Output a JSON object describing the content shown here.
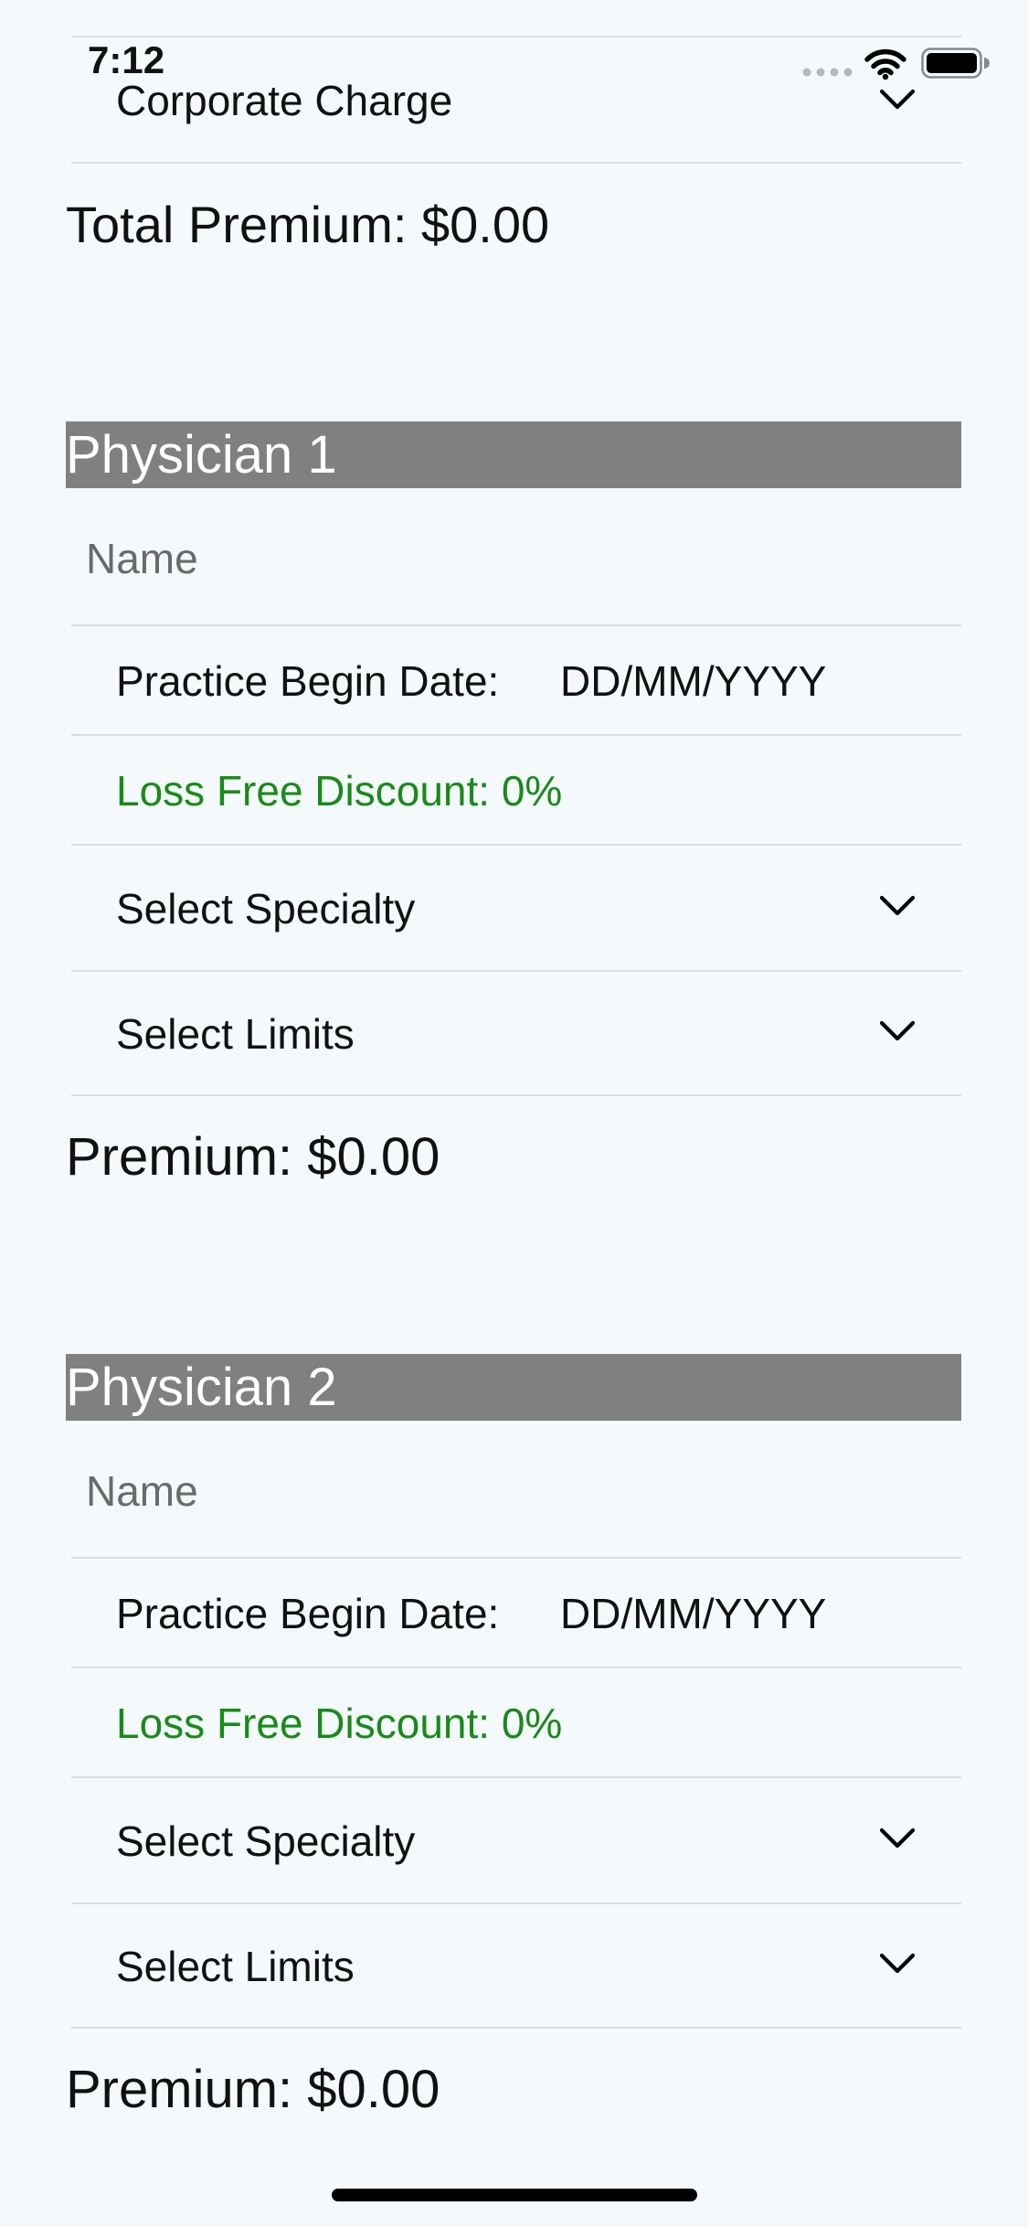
{
  "status_bar": {
    "time": "7:12",
    "icons": [
      "signal-dots-icon",
      "wifi-icon",
      "battery-icon"
    ]
  },
  "corporate_charge": {
    "label": "Corporate Charge",
    "icon": "chevron-down-icon"
  },
  "total_premium": "Total Premium: $0.00",
  "physicians": [
    {
      "title": "Physician 1",
      "name_placeholder": "Name",
      "practice_begin_label": "Practice Begin Date:",
      "practice_begin_value": "DD/MM/YYYY",
      "loss_free_discount": "Loss Free Discount: 0%",
      "specialty_label": "Select Specialty",
      "limits_label": "Select Limits",
      "premium": "Premium: $0.00"
    },
    {
      "title": "Physician 2",
      "name_placeholder": "Name",
      "practice_begin_label": "Practice Begin Date:",
      "practice_begin_value": "DD/MM/YYYY",
      "loss_free_discount": "Loss Free Discount: 0%",
      "specialty_label": "Select Specialty",
      "limits_label": "Select Limits",
      "premium": "Premium: $0.00"
    }
  ],
  "colors": {
    "background": "#f4f9fc",
    "section_header": "#808080",
    "discount_text": "#1a8a1a",
    "divider": "#d9dde0"
  }
}
